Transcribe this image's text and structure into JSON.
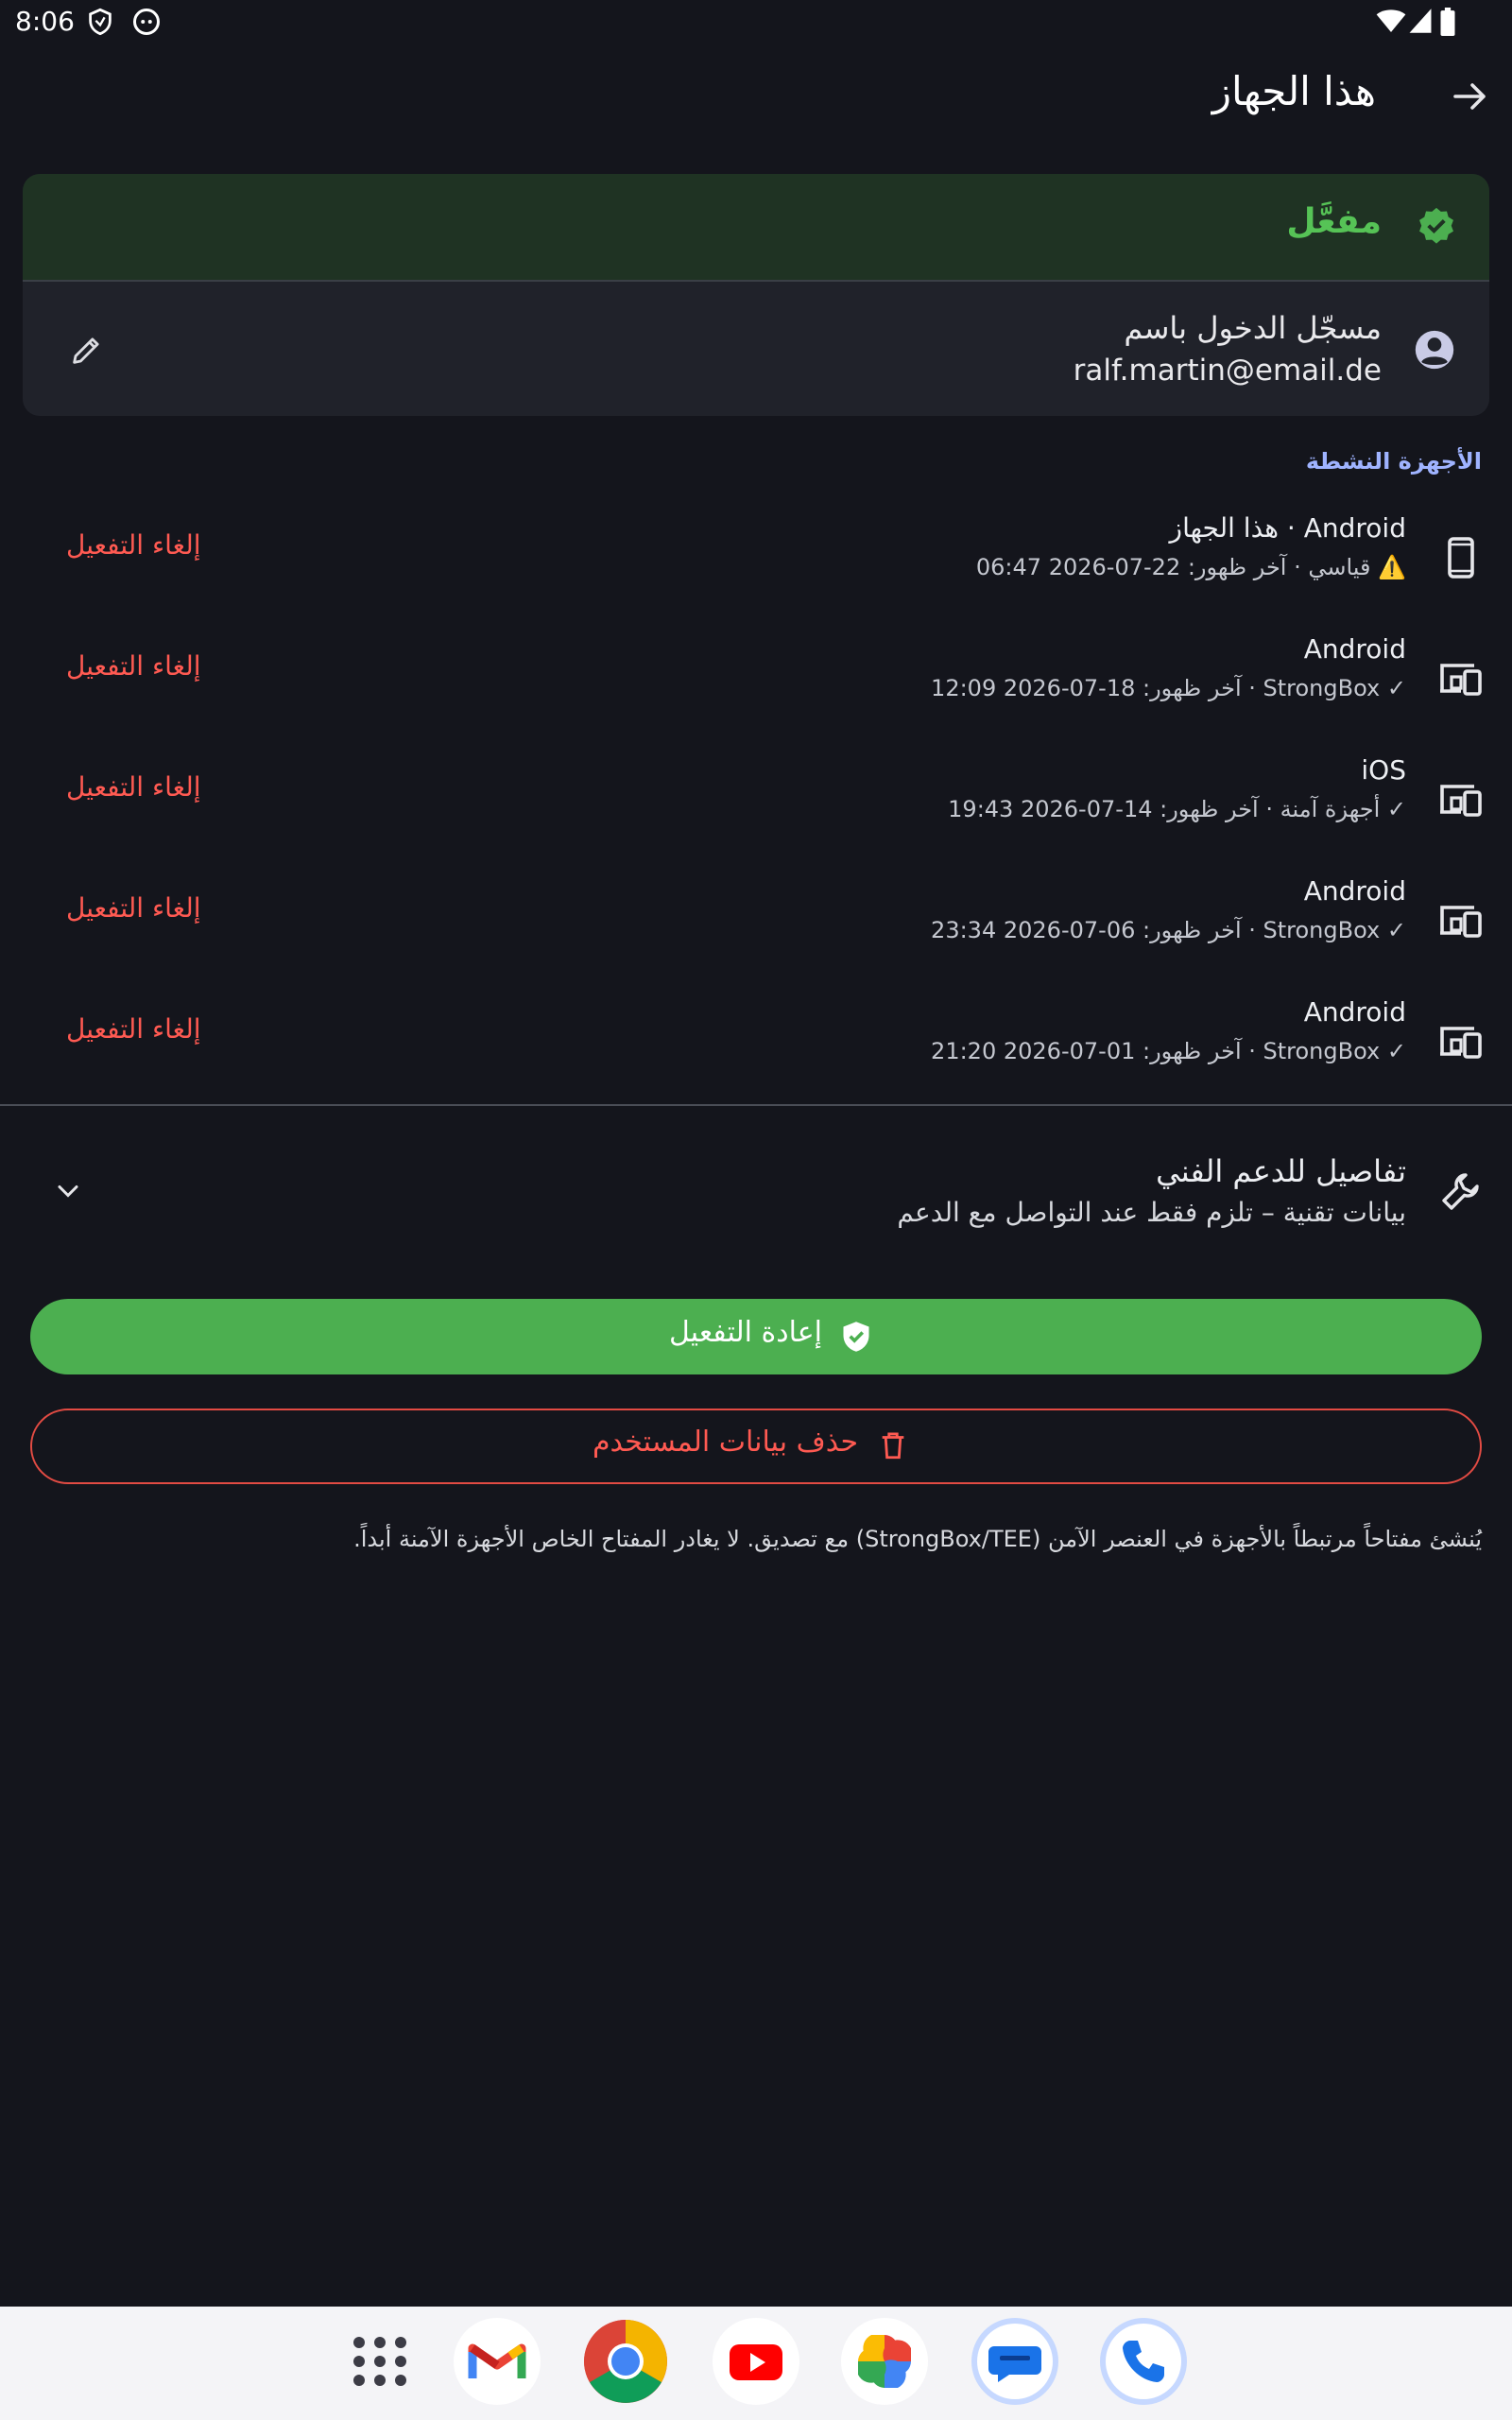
{
  "status_bar": {
    "time": "8:06"
  },
  "app_bar": {
    "title": "هذا الجهاز"
  },
  "account_card": {
    "status": "مفعَّل",
    "signed_in_label": "مسجّل الدخول باسم",
    "email": "ralf.martin@email.de"
  },
  "active_devices": {
    "header": "الأجهزة النشطة",
    "deactivate_label": "إلغاء التفعيل",
    "items": [
      {
        "title": "Android · هذا الجهاز",
        "subtitle": "⚠️ قياسي · آخر ظهور: 22-07-2026 06:47"
      },
      {
        "title": "Android",
        "subtitle": "✓ StrongBox · آخر ظهور: 18-07-2026 12:09"
      },
      {
        "title": "iOS",
        "subtitle": "✓ أجهزة آمنة · آخر ظهور: 14-07-2026 19:43"
      },
      {
        "title": "Android",
        "subtitle": "✓ StrongBox · آخر ظهور: 06-07-2026 23:34"
      },
      {
        "title": "Android",
        "subtitle": "✓ StrongBox · آخر ظهور: 01-07-2026 21:20"
      }
    ]
  },
  "tech_details": {
    "title": "تفاصيل للدعم الفني",
    "subtitle": "بيانات تقنية – تلزم فقط عند التواصل مع الدعم"
  },
  "actions": {
    "reactivate": "إعادة التفعيل",
    "delete": "حذف بيانات المستخدم"
  },
  "footnote": "يُنشئ مفتاحاً مرتبطاً بالأجهزة في العنصر الآمن (StrongBox/TEE) مع تصديق. لا يغادر المفتاح الخاص الأجهزة الآمنة أبداً.",
  "dock": {
    "apps": [
      "apps-grid-icon",
      "gmail-icon",
      "chrome-icon",
      "youtube-icon",
      "photos-icon",
      "messages-icon",
      "phone-icon"
    ]
  },
  "colors": {
    "background": "#14151c",
    "accent_green": "#4caf50",
    "danger_red": "#ff5a52",
    "section_blue": "#9fb3ff"
  }
}
